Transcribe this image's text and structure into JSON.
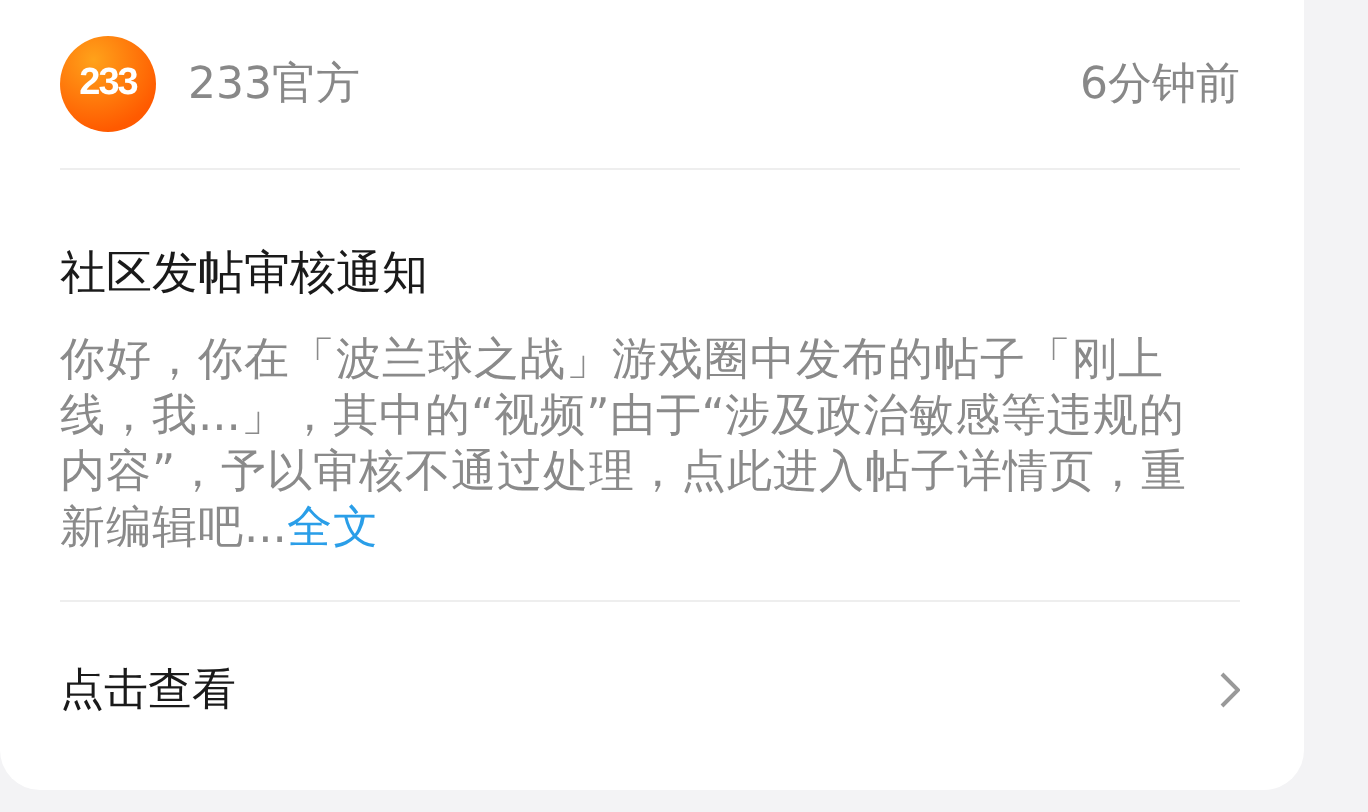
{
  "header": {
    "logo_text": "233",
    "sender": "233官方",
    "time": "6分钟前"
  },
  "notice": {
    "title": "社区发帖审核通知",
    "body": "你好，你在「波兰球之战」游戏圈中发布的帖子「刚上线，我...」，其中的“视频”由于“涉及政治敏感等违规的内容”，予以审核不通过处理，点此进入帖子详情页，重新编辑吧...",
    "more_link": "全文"
  },
  "action": {
    "label": "点击查看"
  }
}
